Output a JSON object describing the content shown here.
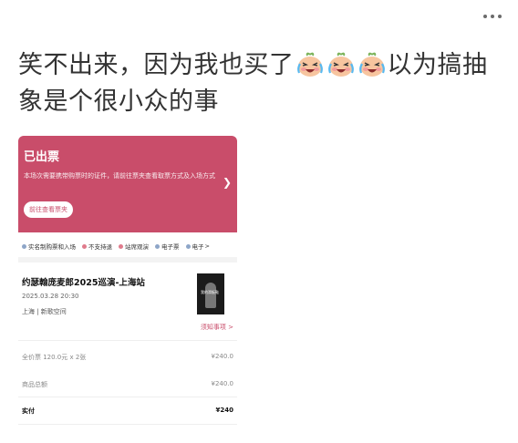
{
  "post": {
    "text_before": "笑不出来，因为我也买了",
    "text_after": "以为搞抽象是个很小众的事",
    "emoji_count": 3
  },
  "ticket": {
    "status": "已出票",
    "description": "本场次需要携带购票时的证件，请前往票夹查看取票方式及入场方式",
    "view_ticket_label": "前往查看票夹",
    "tags": [
      {
        "label": "实名制购票和入场",
        "color": "#8ea6c8"
      },
      {
        "label": "不支持退",
        "color": "#e07b8c"
      },
      {
        "label": "站席观演",
        "color": "#e07b8c"
      },
      {
        "label": "电子票",
        "color": "#8ea6c8"
      },
      {
        "label": "电子",
        "color": "#8ea6c8"
      }
    ],
    "tags_more": ">",
    "show_title": "约瑟翰庞麦郎2025巡演-上海站",
    "show_datetime": "2025.03.28 20:30",
    "show_venue": "上海 | 新歌空间",
    "poster_text": "我的滑板鞋",
    "notice_label": "须知事项 >",
    "lines": [
      {
        "label": "全价票 120.0元 x 2张",
        "value": "¥240.0"
      },
      {
        "label": "商品总额",
        "value": "¥240.0"
      }
    ],
    "paid_label": "实付",
    "paid_value": "¥240"
  },
  "colors": {
    "accent": "#c94d6a"
  }
}
